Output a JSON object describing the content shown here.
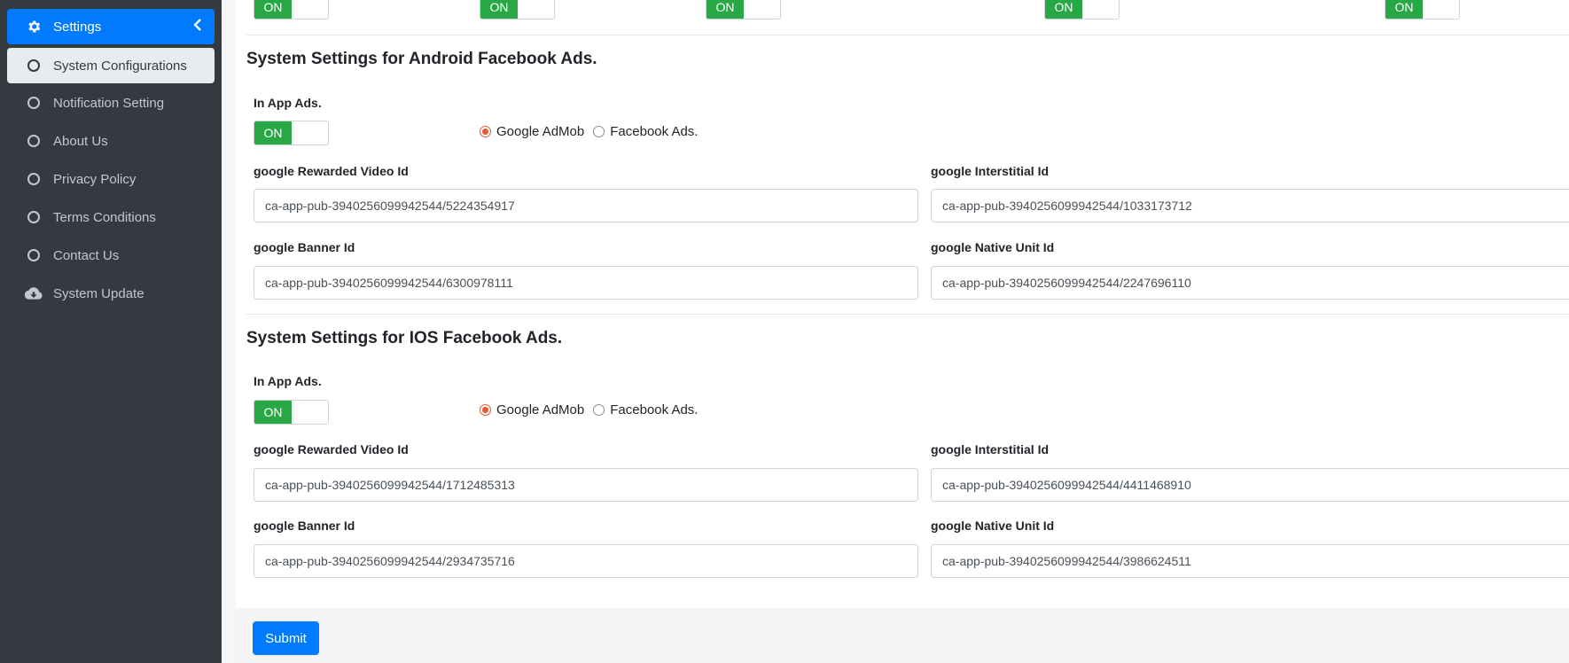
{
  "sidebar": {
    "parent_label": "Settings",
    "items": [
      {
        "label": "System Configurations",
        "icon": "circle-icon"
      },
      {
        "label": "Notification Setting",
        "icon": "circle-icon"
      },
      {
        "label": "About Us",
        "icon": "circle-icon"
      },
      {
        "label": "Privacy Policy",
        "icon": "circle-icon"
      },
      {
        "label": "Terms Conditions",
        "icon": "circle-icon"
      },
      {
        "label": "Contact Us",
        "icon": "circle-icon"
      },
      {
        "label": "System Update",
        "icon": "cloud-download-icon"
      }
    ]
  },
  "top_toggles": [
    "ON",
    "ON",
    "ON",
    "ON",
    "ON"
  ],
  "android": {
    "title": "System Settings for Android Facebook Ads.",
    "in_app_label": "In App Ads.",
    "toggle": "ON",
    "radio_admob": "Google AdMob",
    "radio_facebook": "Facebook Ads.",
    "rewarded_label": "google Rewarded Video Id",
    "rewarded_value": "ca-app-pub-3940256099942544/5224354917",
    "interstitial_label": "google Interstitial Id",
    "interstitial_value": "ca-app-pub-3940256099942544/1033173712",
    "banner_label": "google Banner Id",
    "banner_value": "ca-app-pub-3940256099942544/6300978111",
    "native_label": "google Native Unit Id",
    "native_value": "ca-app-pub-3940256099942544/2247696110"
  },
  "ios": {
    "title": "System Settings for IOS Facebook Ads.",
    "in_app_label": "In App Ads.",
    "toggle": "ON",
    "radio_admob": "Google AdMob",
    "radio_facebook": "Facebook Ads.",
    "rewarded_label": "google Rewarded Video Id",
    "rewarded_value": "ca-app-pub-3940256099942544/1712485313",
    "interstitial_label": "google Interstitial Id",
    "interstitial_value": "ca-app-pub-3940256099942544/4411468910",
    "banner_label": "google Banner Id",
    "banner_value": "ca-app-pub-3940256099942544/2934735716",
    "native_label": "google Native Unit Id",
    "native_value": "ca-app-pub-3940256099942544/3986624511"
  },
  "submit_label": "Submit",
  "colors": {
    "primary": "#007bff",
    "sidebar": "#343a40",
    "toggle_on": "#28a745",
    "radio_checked": "#e8572e"
  }
}
